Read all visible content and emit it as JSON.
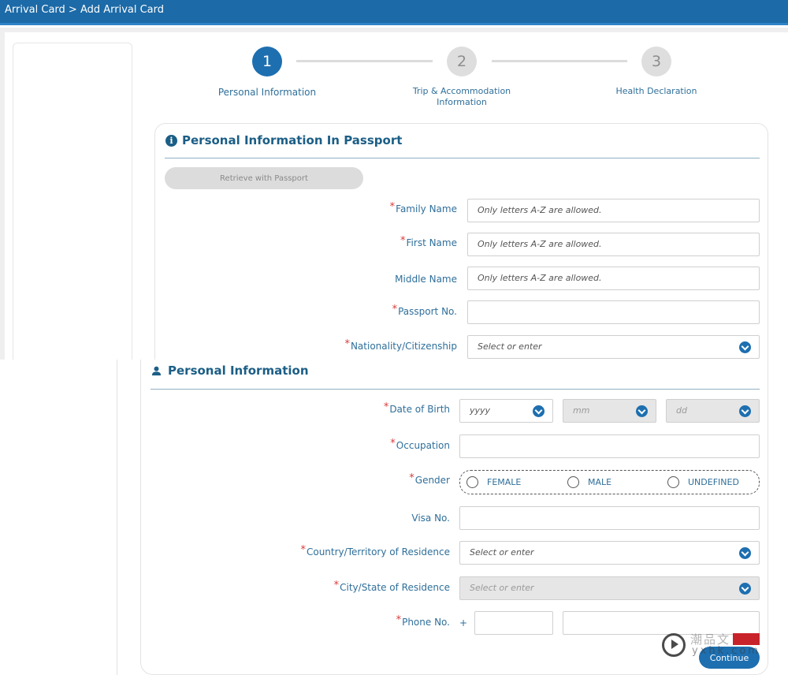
{
  "header": {
    "breadcrumb": "Arrival Card > Add Arrival Card"
  },
  "steps": [
    {
      "number": "1",
      "label": "Personal Information",
      "active": true
    },
    {
      "number": "2",
      "label_line1": "Trip & Accommodation",
      "label_line2": "Information",
      "active": false
    },
    {
      "number": "3",
      "label": "Health Declaration",
      "active": false
    }
  ],
  "passport_section": {
    "title": "Personal Information In Passport",
    "retrieve_button": "Retrieve with Passport",
    "fields": {
      "family_name": {
        "label": "Family Name",
        "required": true,
        "placeholder": "Only letters A-Z are allowed."
      },
      "first_name": {
        "label": "First Name",
        "required": true,
        "placeholder": "Only letters A-Z are allowed."
      },
      "middle_name": {
        "label": "Middle Name",
        "required": false,
        "placeholder": "Only letters A-Z are allowed."
      },
      "passport_no": {
        "label": "Passport No.",
        "required": true,
        "placeholder": ""
      },
      "nationality": {
        "label": "Nationality/Citizenship",
        "required": true,
        "placeholder": "Select or enter"
      }
    }
  },
  "personal_section": {
    "title": "Personal Information",
    "fields": {
      "dob": {
        "label": "Date of Birth",
        "required": true,
        "year": "yyyy",
        "month": "mm",
        "day": "dd"
      },
      "occupation": {
        "label": "Occupation",
        "required": true
      },
      "gender": {
        "label": "Gender",
        "required": true,
        "options": [
          "FEMALE",
          "MALE",
          "UNDEFINED"
        ]
      },
      "visa_no": {
        "label": "Visa No.",
        "required": false
      },
      "country_residence": {
        "label": "Country/Territory of Residence",
        "required": true,
        "placeholder": "Select or enter"
      },
      "city_residence": {
        "label": "City/State of Residence",
        "required": true,
        "placeholder": "Select or enter"
      },
      "phone": {
        "label": "Phone No.",
        "required": true,
        "prefix": "+"
      }
    }
  },
  "actions": {
    "continue": "Continue"
  },
  "watermark": {
    "line1": "潮品文",
    "line2": "yxhk.com"
  },
  "colors": {
    "primary": "#1d6fb0",
    "header": "#1c6aa7",
    "required": "#d83b3b",
    "label": "#2f6f9a"
  }
}
